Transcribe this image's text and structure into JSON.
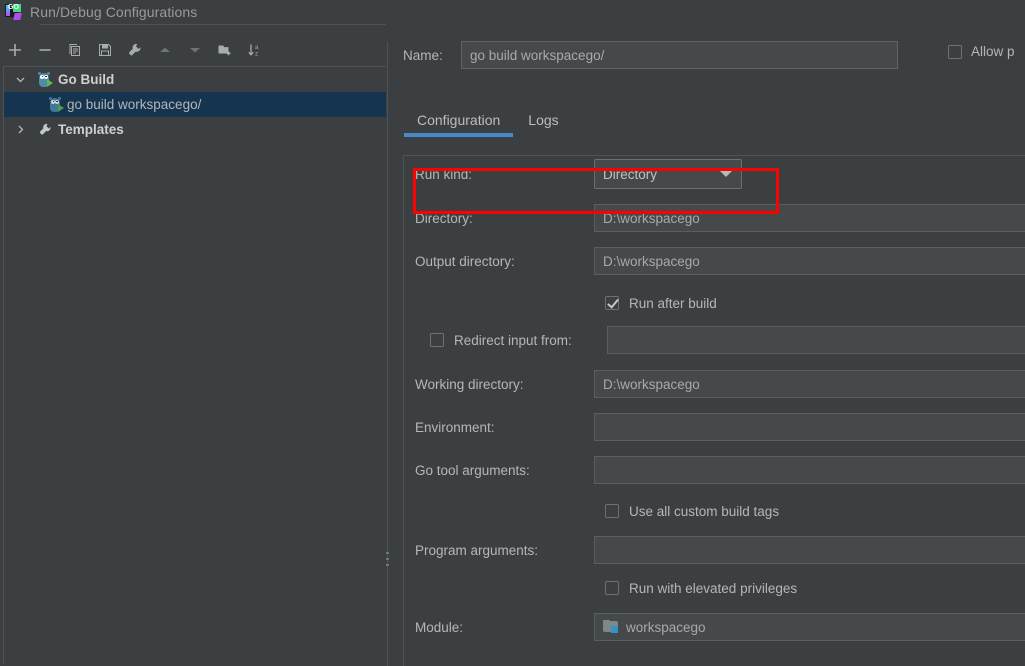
{
  "window": {
    "title": "Run/Debug Configurations",
    "icon": "goland-icon"
  },
  "toolbar": {
    "buttons": [
      {
        "name": "add-configuration",
        "icon": "plus-icon"
      },
      {
        "name": "remove-configuration",
        "icon": "minus-icon"
      },
      {
        "name": "copy-configuration",
        "icon": "copy-icon"
      },
      {
        "name": "save-configuration",
        "icon": "save-icon"
      },
      {
        "name": "edit-templates",
        "icon": "wrench-icon"
      },
      {
        "name": "move-up",
        "icon": "arrow-up-icon"
      },
      {
        "name": "move-down",
        "icon": "arrow-down-icon"
      },
      {
        "name": "new-folder",
        "icon": "folder-add-icon"
      },
      {
        "name": "sort-alphabetically",
        "icon": "sort-az-icon"
      }
    ]
  },
  "tree": {
    "items": [
      {
        "label": "Go Build",
        "icon": "gopher-run-icon",
        "arrow": "chevron-down-icon",
        "level": 0,
        "selected": false,
        "bold": true
      },
      {
        "label": "go build workspacego/",
        "icon": "gopher-run-icon",
        "arrow": "",
        "level": 1,
        "selected": true,
        "bold": false
      },
      {
        "label": "Templates",
        "icon": "wrench-icon",
        "arrow": "chevron-right-icon",
        "level": 0,
        "selected": false,
        "bold": true
      }
    ]
  },
  "details": {
    "name_label": "Name:",
    "name_value": "go build workspacego/",
    "allow_parallel_label": "Allow p",
    "allow_parallel_checked": false,
    "tabs": [
      {
        "label": "Configuration",
        "active": true
      },
      {
        "label": "Logs",
        "active": false
      }
    ],
    "fields": [
      {
        "kind": "combo",
        "label": "Run kind:",
        "value": "Directory",
        "highlighted": true
      },
      {
        "kind": "text",
        "label": "Directory:",
        "value": "D:\\workspacego"
      },
      {
        "kind": "text",
        "label": "Output directory:",
        "value": "D:\\workspacego"
      },
      {
        "kind": "checkbox",
        "label": "Run after build",
        "checked": true
      },
      {
        "kind": "redirect",
        "label": "Redirect input from:",
        "checked": false,
        "value": ""
      },
      {
        "kind": "text",
        "label": "Working directory:",
        "value": "D:\\workspacego"
      },
      {
        "kind": "text",
        "label": "Environment:",
        "value": ""
      },
      {
        "kind": "text",
        "label": "Go tool arguments:",
        "value": ""
      },
      {
        "kind": "checkbox",
        "label": "Use all custom build tags",
        "checked": false
      },
      {
        "kind": "text",
        "label": "Program arguments:",
        "value": ""
      },
      {
        "kind": "checkbox",
        "label": "Run with elevated privileges",
        "checked": false
      },
      {
        "kind": "module",
        "label": "Module:",
        "value": "workspacego",
        "icon": "module-folder-icon"
      }
    ]
  },
  "colors": {
    "background": "#3c3f41",
    "field_background": "#45494a",
    "selection": "#153450",
    "tab_accent": "#4a88c7",
    "highlight_box": "#ff0000",
    "text": "#b6b6b6",
    "module_accent": "#3592c4"
  }
}
